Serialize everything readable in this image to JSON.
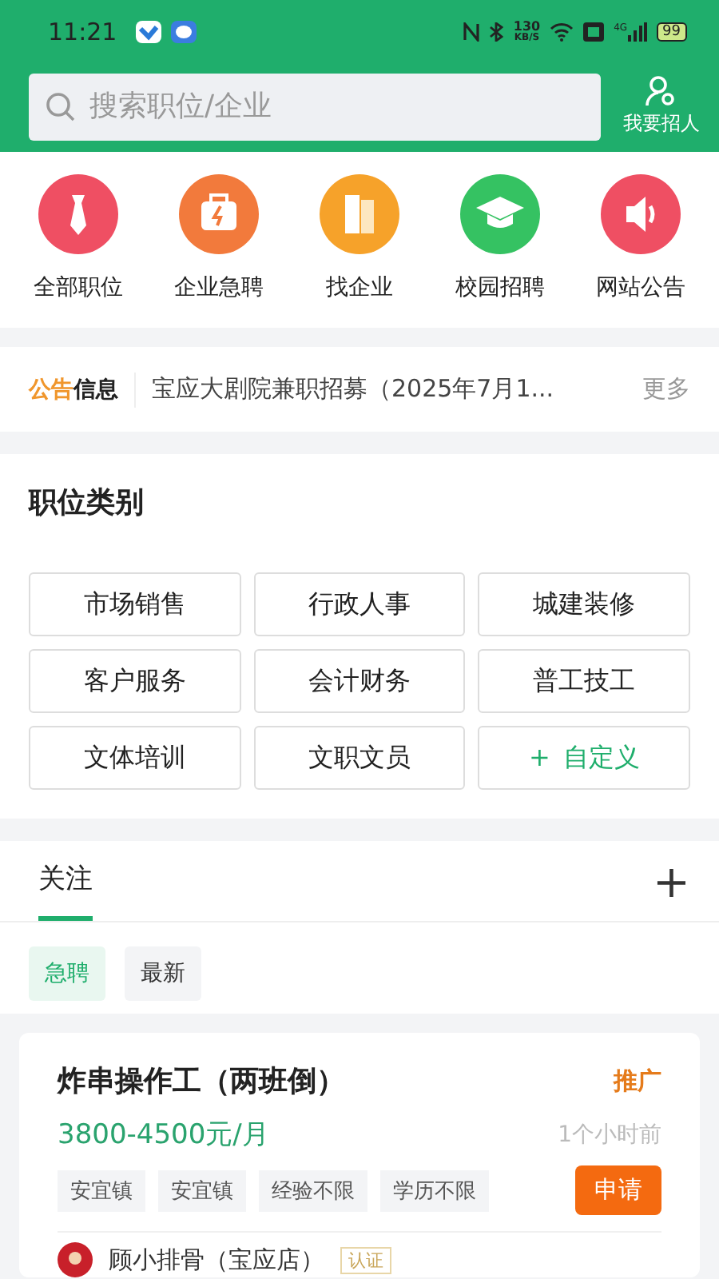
{
  "status_bar": {
    "time": "11:21",
    "speed_value": "130",
    "speed_unit": "KB/S",
    "network": "4G",
    "battery": "99"
  },
  "search": {
    "placeholder": "搜索职位/企业"
  },
  "recruit_button": {
    "label": "我要招人"
  },
  "shortcuts": [
    {
      "label": "全部职位",
      "kind": "tie",
      "color": "#ef4f63"
    },
    {
      "label": "企业急聘",
      "kind": "case",
      "color": "#f27a3c"
    },
    {
      "label": "找企业",
      "kind": "building",
      "color": "#f6a22a"
    },
    {
      "label": "校园招聘",
      "kind": "cap",
      "color": "#35c262"
    },
    {
      "label": "网站公告",
      "kind": "speaker",
      "color": "#ef4f63"
    }
  ],
  "notice": {
    "badge_first": "公告",
    "badge_second": "信息",
    "text": "宝应大剧院兼职招募（2025年7月1...",
    "more": "更多"
  },
  "categories": {
    "title": "职位类别",
    "items": [
      {
        "label": "市场销售",
        "kind": "plain"
      },
      {
        "label": "行政人事",
        "kind": "plain"
      },
      {
        "label": "城建装修",
        "kind": "plain"
      },
      {
        "label": "客户服务",
        "kind": "plain"
      },
      {
        "label": "会计财务",
        "kind": "plain"
      },
      {
        "label": "普工技工",
        "kind": "plain"
      },
      {
        "label": "文体培训",
        "kind": "plain"
      },
      {
        "label": "文职文员",
        "kind": "plain"
      },
      {
        "label": "自定义",
        "kind": "add",
        "icon": "+"
      }
    ]
  },
  "follow": {
    "tab": "关注",
    "add": "+",
    "filters": [
      {
        "label": "急聘",
        "selected": true
      },
      {
        "label": "最新",
        "selected": false
      }
    ]
  },
  "job": {
    "title": "炸串操作工（两班倒）",
    "promo": "推广",
    "salary": "3800-4500元/月",
    "time": "1个小时前",
    "tags": [
      "安宜镇",
      "安宜镇",
      "经验不限",
      "学历不限"
    ],
    "apply": "申请",
    "company": "顾小排骨（宝应店）",
    "verified": "认证"
  }
}
